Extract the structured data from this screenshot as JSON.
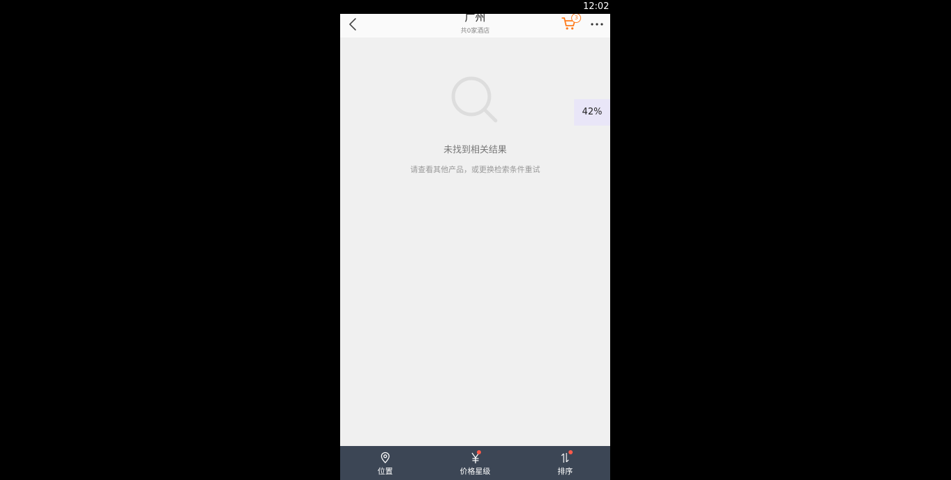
{
  "status_bar": {
    "time": "12:02"
  },
  "header": {
    "title": "广州",
    "subtitle": "共0家酒店",
    "back_icon": "chevron-left-icon",
    "cart_icon": "cart-icon",
    "cart_badge": "3",
    "more_icon": "more-dots-icon"
  },
  "empty_state": {
    "icon": "search-icon",
    "title": "未找到相关结果",
    "hint": "请查看其他产品，或更换检索条件重试"
  },
  "progress_overlay": {
    "text": "42%",
    "value": 0.42
  },
  "tab_bar": {
    "items": [
      {
        "label": "位置",
        "icon": "location-pin-icon",
        "has_dot": false
      },
      {
        "label": "价格星级",
        "icon": "yen-icon",
        "has_dot": true
      },
      {
        "label": "排序",
        "icon": "sort-arrows-icon",
        "has_dot": true
      }
    ]
  },
  "colors": {
    "accent": "#ff7a1a",
    "tab_bar_bg": "#3c4655",
    "badge_dot": "#ff5a4a",
    "content_bg": "#f0f0f0"
  }
}
